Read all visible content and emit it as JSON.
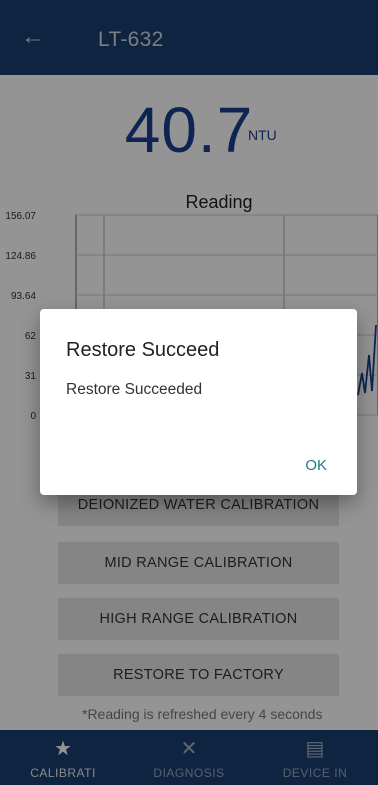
{
  "header": {
    "title": "LT-632"
  },
  "reading": {
    "value": "40.7",
    "unit": "NTU"
  },
  "chart_data": {
    "type": "line",
    "title": "Reading",
    "y_ticks": [
      "156.07",
      "124.86",
      "93.64",
      "62",
      "31",
      "0"
    ]
  },
  "buttons": {
    "deionized": "DEIONIZED WATER CALIBRATION",
    "mid": "MID RANGE CALIBRATION",
    "high": "HIGH RANGE CALIBRATION",
    "restore": "RESTORE TO FACTORY"
  },
  "note": "*Reading is refreshed every 4 seconds",
  "dialog": {
    "title": "Restore Succeed",
    "message": "Restore Succeeded",
    "ok": "OK"
  },
  "bottom_nav": [
    {
      "label": "CALIBRATI",
      "icon": "star-icon"
    },
    {
      "label": "DIAGNOSIS",
      "icon": "tools-icon"
    },
    {
      "label": "DEVICE IN",
      "icon": "document-icon"
    }
  ]
}
